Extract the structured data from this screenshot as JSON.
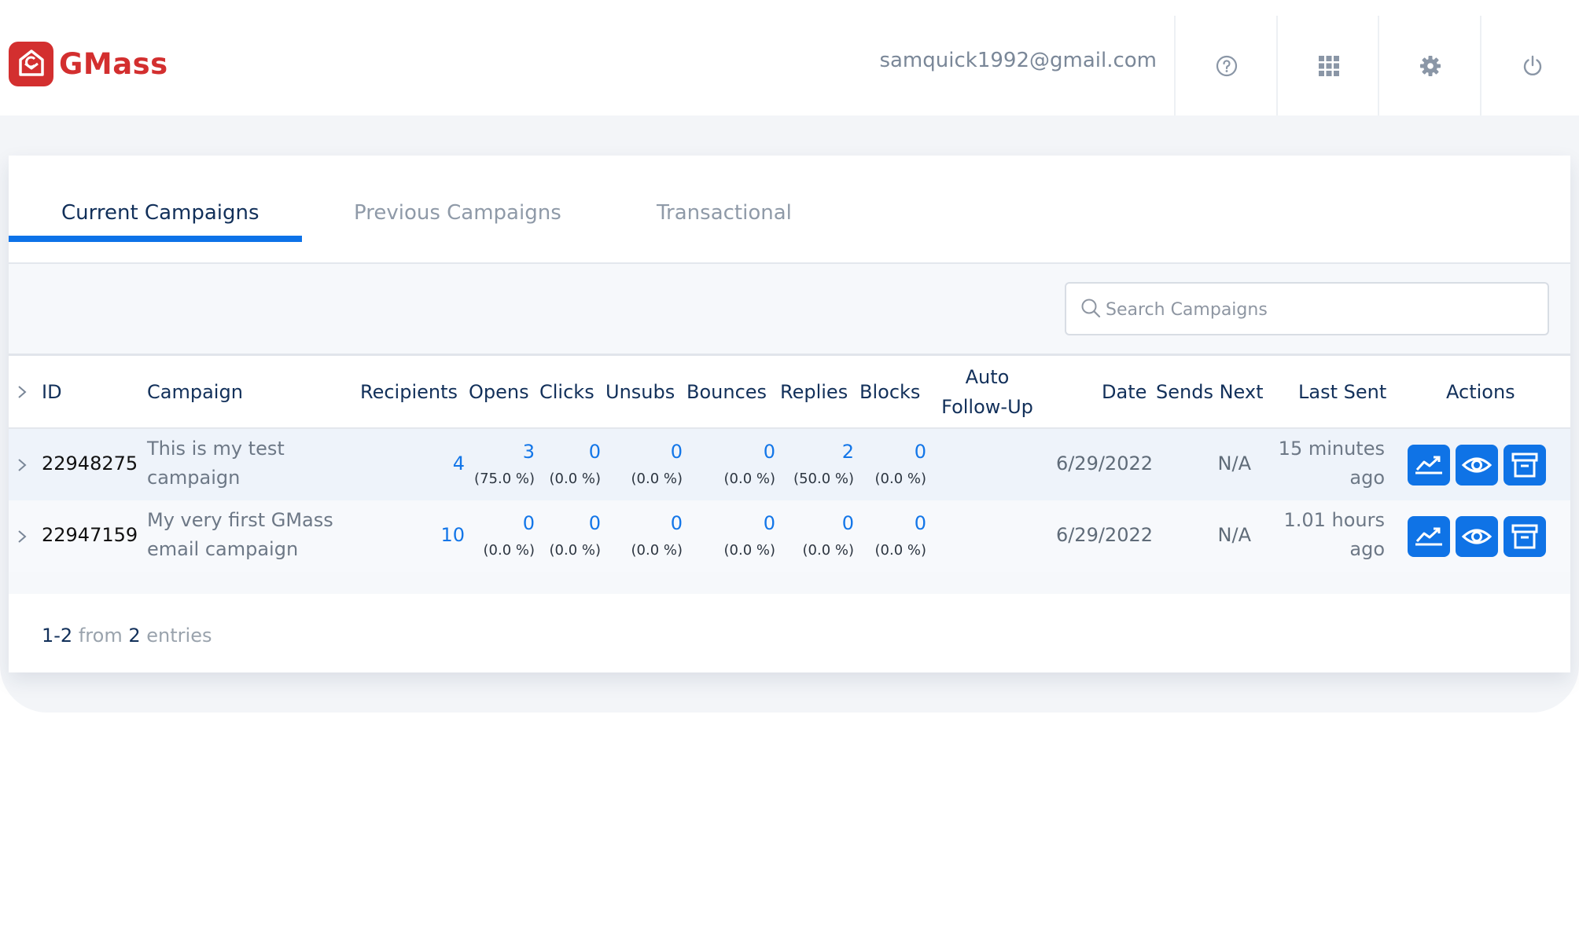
{
  "app": {
    "name": "GMass",
    "brand_color": "#d32f2f",
    "accent_color": "#0d72e8"
  },
  "header": {
    "email": "samquick1992@gmail.com",
    "icons": [
      "help-icon",
      "apps-grid-icon",
      "settings-gear-icon",
      "power-icon"
    ]
  },
  "tabs": [
    {
      "label": "Current Campaigns",
      "active": true
    },
    {
      "label": "Previous Campaigns",
      "active": false
    },
    {
      "label": "Transactional",
      "active": false
    }
  ],
  "search": {
    "placeholder": "Search Campaigns",
    "value": ""
  },
  "table": {
    "columns": {
      "id": "ID",
      "campaign": "Campaign",
      "recipients": "Recipients",
      "opens": "Opens",
      "clicks": "Clicks",
      "unsubs": "Unsubs",
      "bounces": "Bounces",
      "replies": "Replies",
      "blocks": "Blocks",
      "auto_line1": "Auto",
      "auto_line2": "Follow-Up",
      "date": "Date",
      "sends_next": "Sends Next",
      "last_sent": "Last Sent",
      "actions": "Actions"
    },
    "rows": [
      {
        "id": "22948275",
        "campaign_line1": "This is my test",
        "campaign_line2": "campaign",
        "recipients": "4",
        "opens": "3",
        "opens_pct": "(75.0 %)",
        "clicks": "0",
        "clicks_pct": "(0.0 %)",
        "unsubs": "0",
        "unsubs_pct": "(0.0 %)",
        "bounces": "0",
        "bounces_pct": "(0.0 %)",
        "replies": "2",
        "replies_pct": "(50.0 %)",
        "blocks": "0",
        "blocks_pct": "(0.0 %)",
        "date": "6/29/2022",
        "sends_next": "N/A",
        "last_sent_line1": "15 minutes",
        "last_sent_line2": "ago"
      },
      {
        "id": "22947159",
        "campaign_line1": "My very first GMass",
        "campaign_line2": "email campaign",
        "recipients": "10",
        "opens": "0",
        "opens_pct": "(0.0 %)",
        "clicks": "0",
        "clicks_pct": "(0.0 %)",
        "unsubs": "0",
        "unsubs_pct": "(0.0 %)",
        "bounces": "0",
        "bounces_pct": "(0.0 %)",
        "replies": "0",
        "replies_pct": "(0.0 %)",
        "blocks": "0",
        "blocks_pct": "(0.0 %)",
        "date": "6/29/2022",
        "sends_next": "N/A",
        "last_sent_line1": "1.01 hours",
        "last_sent_line2": "ago"
      }
    ],
    "action_icons": [
      "stats-chart-icon",
      "view-eye-icon",
      "archive-icon"
    ]
  },
  "pagination": {
    "range": "1-2",
    "from_word": "from",
    "total": "2",
    "entries_word": "entries"
  }
}
